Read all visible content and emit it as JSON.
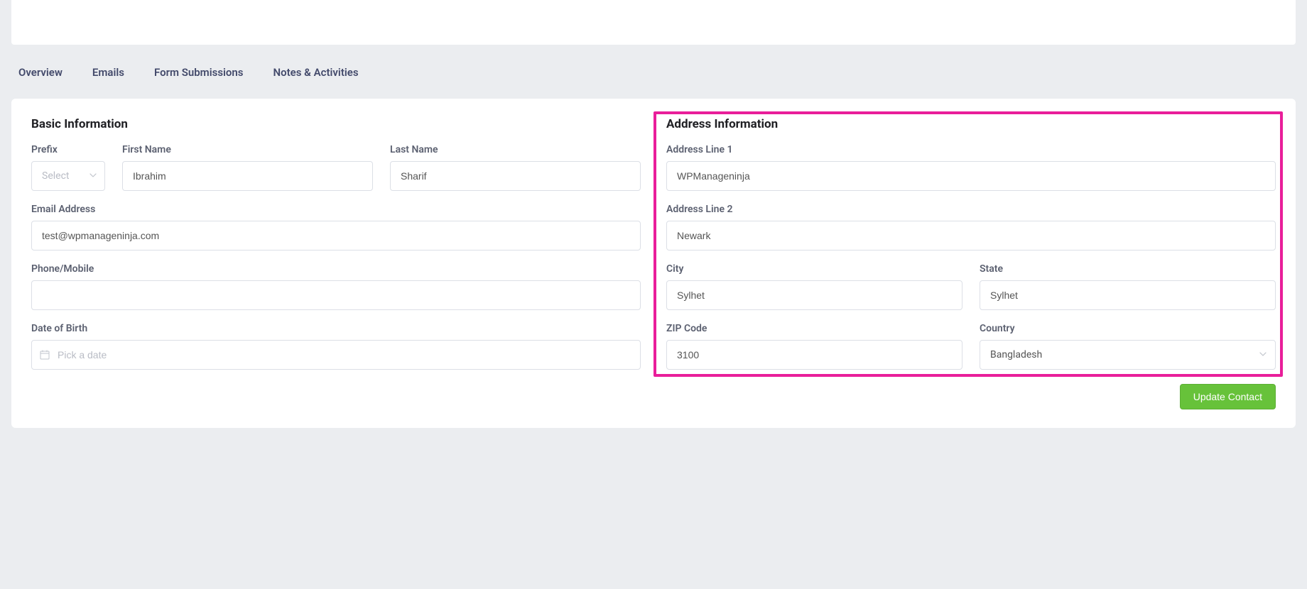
{
  "tabs": {
    "overview": "Overview",
    "emails": "Emails",
    "form_submissions": "Form Submissions",
    "notes": "Notes & Activities"
  },
  "basic": {
    "title": "Basic Information",
    "prefix_label": "Prefix",
    "prefix_placeholder": "Select",
    "first_name_label": "First Name",
    "first_name_value": "Ibrahim",
    "last_name_label": "Last Name",
    "last_name_value": "Sharif",
    "email_label": "Email Address",
    "email_value": "test@wpmanageninja.com",
    "phone_label": "Phone/Mobile",
    "phone_value": "",
    "dob_label": "Date of Birth",
    "dob_placeholder": "Pick a date"
  },
  "address": {
    "title": "Address Information",
    "line1_label": "Address Line 1",
    "line1_value": "WPManageninja",
    "line2_label": "Address Line 2",
    "line2_value": "Newark",
    "city_label": "City",
    "city_value": "Sylhet",
    "state_label": "State",
    "state_value": "Sylhet",
    "zip_label": "ZIP Code",
    "zip_value": "3100",
    "country_label": "Country",
    "country_value": "Bangladesh"
  },
  "actions": {
    "update_label": "Update Contact"
  }
}
